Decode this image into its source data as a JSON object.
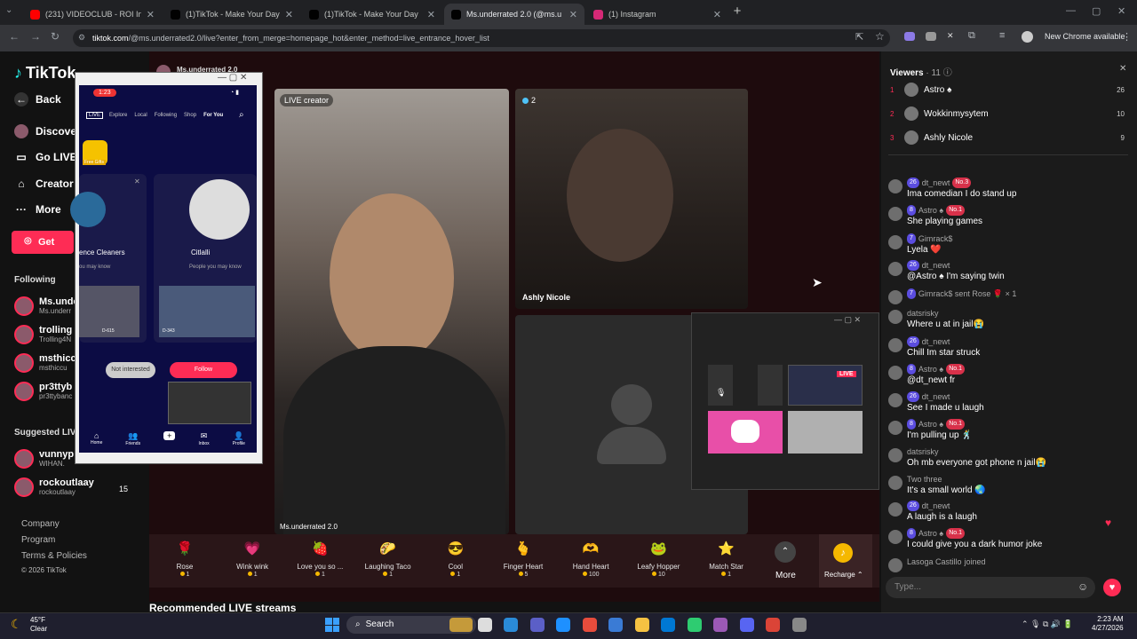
{
  "browser": {
    "tabs": [
      {
        "label": "(231) VIDEOCLUB - ROI Instrum",
        "color": "#ff0000",
        "active": false
      },
      {
        "label": "(1)TikTok - Make Your Day",
        "color": "#010101",
        "active": false
      },
      {
        "label": "(1)TikTok - Make Your Day",
        "color": "#010101",
        "active": false
      },
      {
        "label": "Ms.underrated 2.0 (@ms.u",
        "color": "#010101",
        "active": true
      },
      {
        "label": "(1) Instagram",
        "color": "#d62976",
        "active": false
      }
    ],
    "url_host": "tiktok.com",
    "url_path": "/@ms.underrated2.0/live?enter_from_merge=homepage_hot&enter_method=live_entrance_hover_list",
    "new_chrome_label": "New Chrome available"
  },
  "sidebar": {
    "logo": "TikTok",
    "back_label": "Back",
    "nav": [
      "Discove",
      "Go LIVE",
      "Creator",
      "More"
    ],
    "get_label": "Get",
    "following_header": "Following",
    "following": [
      {
        "name": "Ms.unde",
        "sub": "Ms.underr"
      },
      {
        "name": "trolling",
        "sub": "Trolling4N"
      },
      {
        "name": "msthicc",
        "sub": "msthiccu"
      },
      {
        "name": "pr3ttyb",
        "sub": "pr3ttybanc"
      }
    ],
    "suggested_header": "Suggested LIV",
    "suggested": [
      {
        "name": "vunnyp",
        "sub": "WIHAN."
      },
      {
        "name": "rockoutlaay",
        "sub": "rockoutlaay",
        "count": "15"
      }
    ],
    "footer": [
      "Company",
      "Program",
      "Terms & Policies",
      "© 2026 TikTok"
    ]
  },
  "live": {
    "host_name": "Ms.underrated 2.0",
    "main_label": "LIVE creator",
    "main_caption": "Ms.underrated 2.0",
    "guest_count": "2",
    "guest_name": "Ashly Nicole",
    "recommended_title": "Recommended LIVE streams"
  },
  "gifts": [
    {
      "name": "Rose",
      "cost": "1",
      "icon": "🌹"
    },
    {
      "name": "Wink wink",
      "cost": "1",
      "icon": "💗"
    },
    {
      "name": "Love you so ...",
      "cost": "1",
      "icon": "🍓"
    },
    {
      "name": "Laughing Taco",
      "cost": "1",
      "icon": "🌮"
    },
    {
      "name": "Cool",
      "cost": "1",
      "icon": "😎"
    },
    {
      "name": "Finger Heart",
      "cost": "5",
      "icon": "🫰"
    },
    {
      "name": "Hand Heart",
      "cost": "100",
      "icon": "🫶"
    },
    {
      "name": "Leafy Hopper",
      "cost": "10",
      "icon": "🐸"
    },
    {
      "name": "Match Star",
      "cost": "1",
      "icon": "⭐"
    }
  ],
  "gift_more_label": "More",
  "recharge_label": "Recharge",
  "phone": {
    "time": "1:23",
    "tabs": [
      "Explore",
      "Local",
      "Following",
      "Shop",
      "For You"
    ],
    "card1": "ence Cleaners",
    "card1_sub": "ou may know",
    "card2": "Citlalli",
    "card2_sub": "People you may know",
    "not_interested": "Not interested",
    "follow": "Follow",
    "nav": [
      "Home",
      "Friends",
      "",
      "Inbox",
      "Profile"
    ],
    "free_gifts": "Free Gifts",
    "thumb1": "D-615",
    "thumb2": "D-343"
  },
  "float_window": {
    "live_badge": "LIVE"
  },
  "viewers": {
    "title": "Viewers",
    "count": "11",
    "list": [
      {
        "rank": "1",
        "name": "Astro ♠",
        "score": "26"
      },
      {
        "rank": "2",
        "name": "Wokkinmysytem",
        "score": "10"
      },
      {
        "rank": "3",
        "name": "Ashly Nicole",
        "score": "9"
      }
    ]
  },
  "chat": [
    {
      "user": "dt_newt",
      "level": "26",
      "rank": "No.3",
      "text": "Ima comedian I do stand up"
    },
    {
      "user": "Astro ♠",
      "level": "8",
      "rank": "No.1",
      "text": "She playing games"
    },
    {
      "user": "Gimrack$",
      "level": "7",
      "rank": "",
      "text": "Lyela ❤️"
    },
    {
      "user": "dt_newt",
      "level": "26",
      "rank": "",
      "text": "@Astro ♠ I'm saying twin"
    },
    {
      "user": "Gimrack$ sent Rose 🌹 × 1",
      "level": "7",
      "rank": "",
      "text": ""
    },
    {
      "user": "datsrisky",
      "level": "",
      "rank": "",
      "text": "Where u at in jail😭"
    },
    {
      "user": "dt_newt",
      "level": "26",
      "rank": "",
      "text": "Chill Im star struck"
    },
    {
      "user": "Astro ♠",
      "level": "8",
      "rank": "No.1",
      "text": "@dt_newt fr"
    },
    {
      "user": "dt_newt",
      "level": "26",
      "rank": "",
      "text": "See I made u laugh"
    },
    {
      "user": "Astro ♠",
      "level": "8",
      "rank": "No.1",
      "text": "I'm pulling up 🕺"
    },
    {
      "user": "datsrisky",
      "level": "",
      "rank": "",
      "text": "Oh mb everyone got phone n jail😭"
    },
    {
      "user": "Two three",
      "level": "",
      "rank": "",
      "text": "It's a small world 🌏"
    },
    {
      "user": "dt_newt",
      "level": "26",
      "rank": "",
      "text": "A laugh is a laugh"
    },
    {
      "user": "Astro ♠",
      "level": "8",
      "rank": "No.1",
      "text": "I could give you a dark humor joke"
    },
    {
      "user": "Lasoga Castillo",
      "level": "",
      "rank": "",
      "text": "joined"
    }
  ],
  "chat_placeholder": "Type...",
  "taskbar": {
    "weather_temp": "45°F",
    "weather_desc": "Clear",
    "search_label": "Search",
    "time": "2:23 AM",
    "date": "4/27/2026"
  }
}
